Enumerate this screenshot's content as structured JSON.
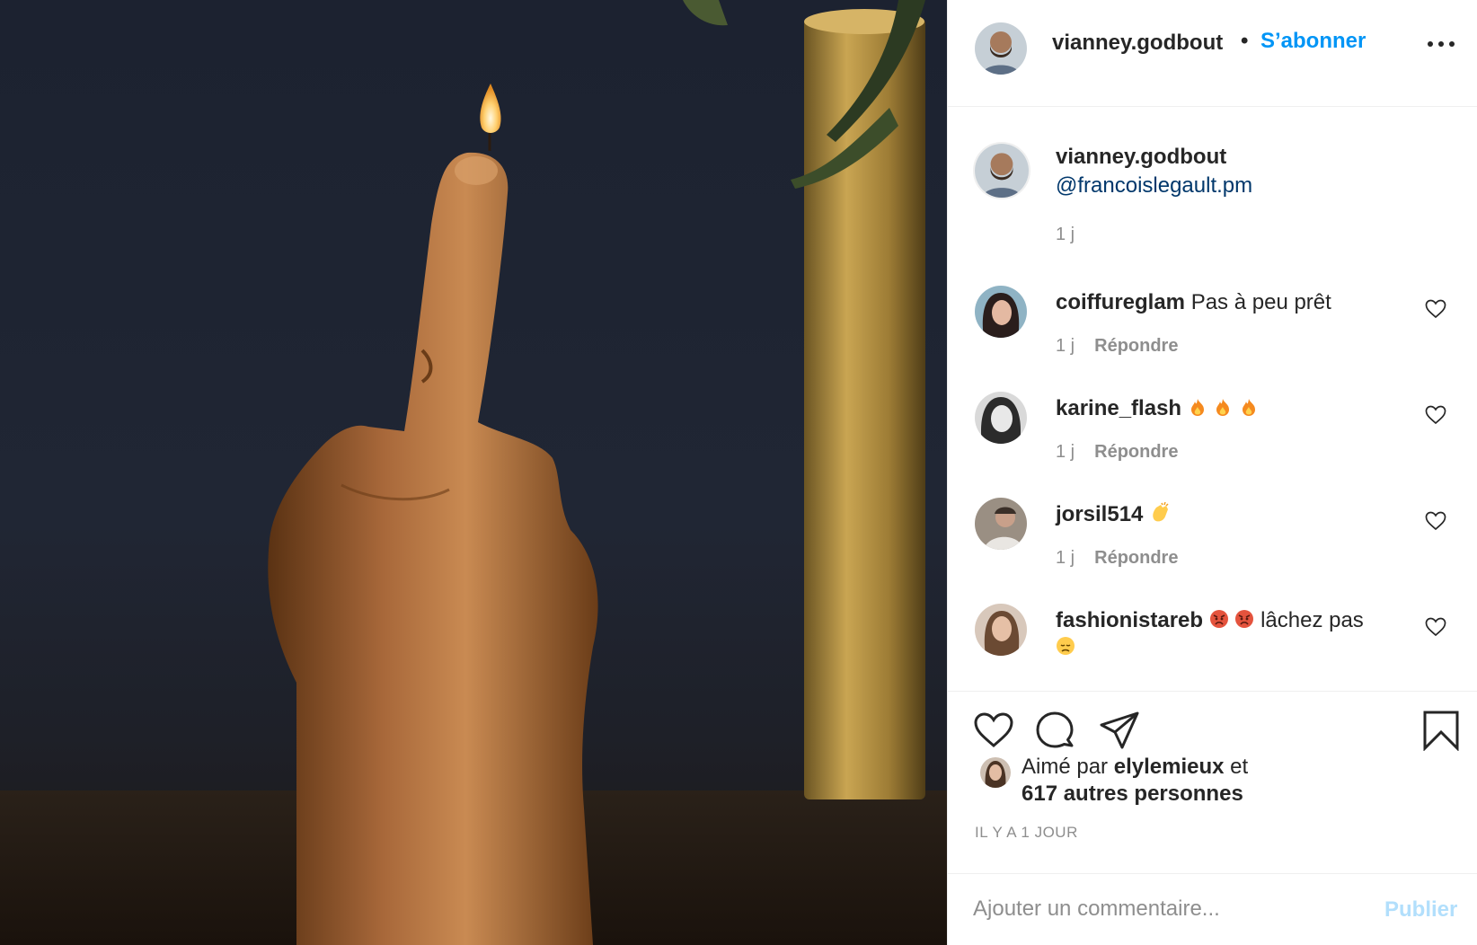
{
  "post": {
    "author": "vianney.godbout",
    "follow_label": "S’abonner",
    "separator": "•",
    "caption_user": "vianney.godbout",
    "caption_text": "@francoislegault.pm",
    "caption_time": "1 j"
  },
  "comments": [
    {
      "user": "coiffureglam",
      "text": "Pas à peu prêt",
      "emojis": [],
      "time": "1 j",
      "reply_label": "Répondre"
    },
    {
      "user": "karine_flash",
      "text": "",
      "emojis": [
        "fire-emoji",
        "fire-emoji",
        "fire-emoji"
      ],
      "time": "1 j",
      "reply_label": "Répondre"
    },
    {
      "user": "jorsil514",
      "text": "",
      "emojis": [
        "clap-emoji"
      ],
      "time": "1 j",
      "reply_label": "Répondre"
    },
    {
      "user": "fashionistareb",
      "text": "lâchez pas",
      "emojis": [
        "angry-emoji",
        "angry-emoji",
        "disappointed-emoji"
      ]
    }
  ],
  "likes": {
    "prefix": "Aimé par",
    "liker": "elylemieux",
    "joiner": "et",
    "others": "617 autres personnes"
  },
  "time_ago": "IL Y A 1 JOUR",
  "comment_box": {
    "placeholder": "Ajouter un commentaire...",
    "publish_label": "Publier"
  },
  "colors": {
    "accent": "#0095f6",
    "publish_disabled": "#b2dffc",
    "muted": "#8e8e8e",
    "link": "#00376b"
  }
}
